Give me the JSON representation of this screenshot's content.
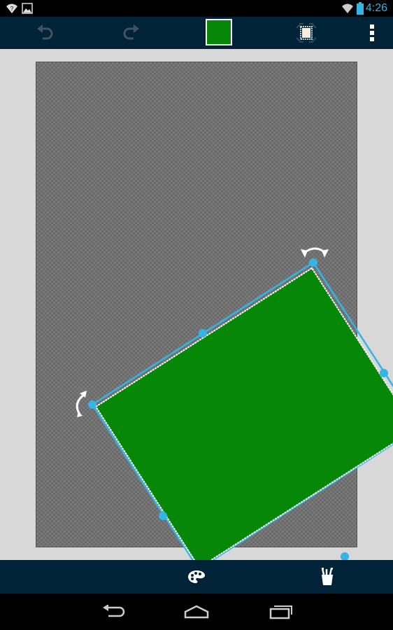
{
  "status_bar": {
    "time": "4:26",
    "icons": [
      "wifi-signal-icon",
      "image-notification-icon",
      "wifi-icon",
      "battery-icon"
    ]
  },
  "toolbar": {
    "buttons": [
      "undo-icon",
      "redo-icon",
      "fill-color-swatch",
      "canvas-crop-icon",
      "overflow-menu-icon"
    ],
    "current_color": "#078707"
  },
  "canvas": {
    "background_pattern": "transparent-checkerboard",
    "selected_shape": {
      "type": "rectangle",
      "fill_color": "#078707",
      "selection_color": "#33b5e5",
      "handles": [
        "rotate-handle-top",
        "rotate-handle-left",
        "resize-handles"
      ]
    }
  },
  "bottom_bar": {
    "buttons": [
      "palette-icon",
      "brush-tools-icon"
    ]
  },
  "nav_bar": {
    "buttons": [
      "back-icon",
      "home-icon",
      "recent-apps-icon"
    ]
  }
}
